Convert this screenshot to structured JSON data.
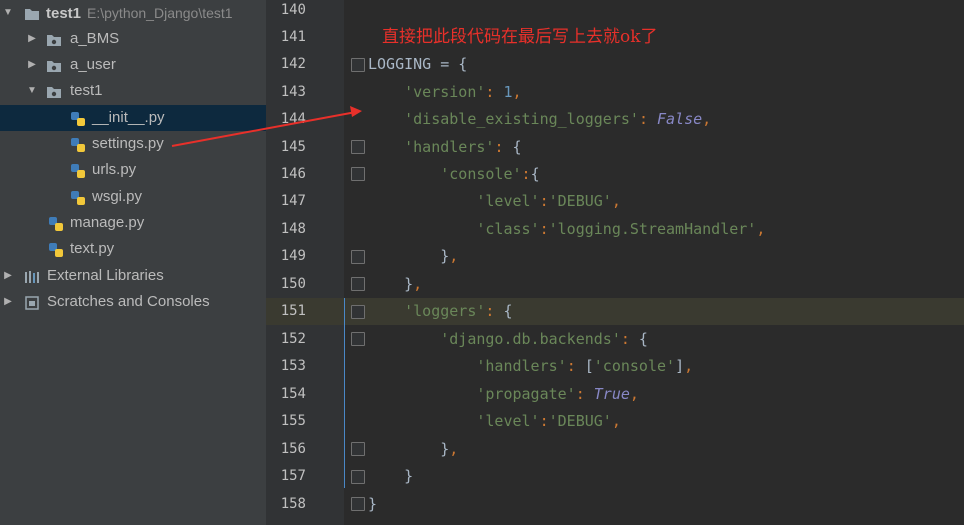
{
  "project_tree": {
    "root": {
      "label": "test1",
      "path": "E:\\python_Django\\test1"
    },
    "items": [
      {
        "label": "a_BMS",
        "kind": "folder",
        "expanded": false
      },
      {
        "label": "a_user",
        "kind": "folder",
        "expanded": false
      },
      {
        "label": "test1",
        "kind": "folder",
        "expanded": true
      },
      {
        "label": "__init__.py",
        "kind": "python-file",
        "selected": true
      },
      {
        "label": "settings.py",
        "kind": "python-file"
      },
      {
        "label": "urls.py",
        "kind": "python-file"
      },
      {
        "label": "wsgi.py",
        "kind": "python-file"
      },
      {
        "label": "manage.py",
        "kind": "python-file"
      },
      {
        "label": "text.py",
        "kind": "python-file"
      },
      {
        "label": "External Libraries",
        "kind": "library"
      },
      {
        "label": "Scratches and Consoles",
        "kind": "scratches"
      }
    ]
  },
  "editor": {
    "annotation": "直接把此段代码在最后写上去就ok了",
    "lines": [
      {
        "n": "140",
        "text": ""
      },
      {
        "n": "141",
        "text": ""
      },
      {
        "n": "142",
        "text": "LOGGING = {"
      },
      {
        "n": "143",
        "text": "    'version': 1,"
      },
      {
        "n": "144",
        "text": "    'disable_existing_loggers': False,"
      },
      {
        "n": "145",
        "text": "    'handlers': {"
      },
      {
        "n": "146",
        "text": "        'console':{"
      },
      {
        "n": "147",
        "text": "            'level':'DEBUG',"
      },
      {
        "n": "148",
        "text": "            'class':'logging.StreamHandler',"
      },
      {
        "n": "149",
        "text": "        },"
      },
      {
        "n": "150",
        "text": "    },"
      },
      {
        "n": "151",
        "text": "    'loggers': {"
      },
      {
        "n": "152",
        "text": "        'django.db.backends': {"
      },
      {
        "n": "153",
        "text": "            'handlers': ['console'],"
      },
      {
        "n": "154",
        "text": "            'propagate': True,"
      },
      {
        "n": "155",
        "text": "            'level':'DEBUG',"
      },
      {
        "n": "156",
        "text": "        },"
      },
      {
        "n": "157",
        "text": "    }"
      },
      {
        "n": "158",
        "text": "}"
      }
    ],
    "current_line": "151"
  },
  "colors": {
    "sidebar_bg": "#3c3f41",
    "editor_bg": "#2b2b2b",
    "string": "#6a8759",
    "keyword": "#cc7832",
    "number": "#6897bb",
    "annotation": "#e8302a"
  }
}
